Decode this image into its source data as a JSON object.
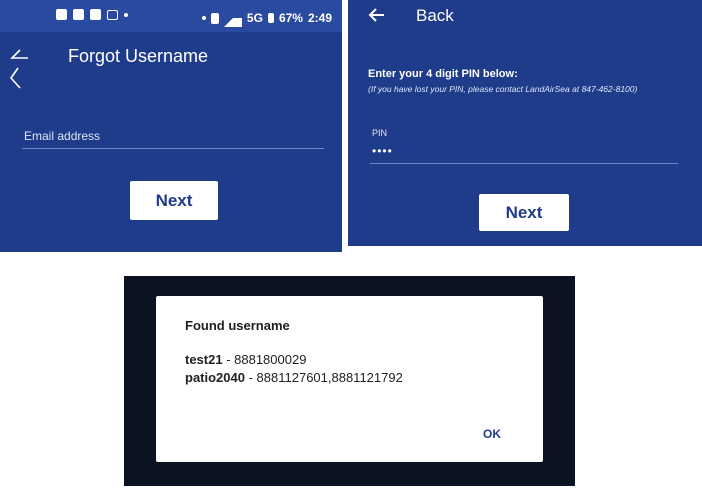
{
  "forgot_screen": {
    "status_bar": {
      "network": "5G",
      "battery": "67%",
      "time": "2:49"
    },
    "title": "Forgot Username",
    "email_field": {
      "label": "Email address",
      "value": ""
    },
    "next_label": "Next"
  },
  "pin_screen": {
    "back_label": "Back",
    "heading": "Enter your 4 digit PIN below:",
    "note": "(If you have lost your PIN, please contact LandAirSea at 847-462-8100)",
    "pin_field": {
      "label": "PIN",
      "value": "••••"
    },
    "next_label": "Next"
  },
  "found_dialog": {
    "title": "Found username",
    "entries": [
      {
        "username": "test21",
        "separator": " - ",
        "numbers": "8881800029"
      },
      {
        "username": "patio2040",
        "separator": " - ",
        "numbers": "8881127601,8881121792"
      }
    ],
    "ok_label": "OK"
  }
}
